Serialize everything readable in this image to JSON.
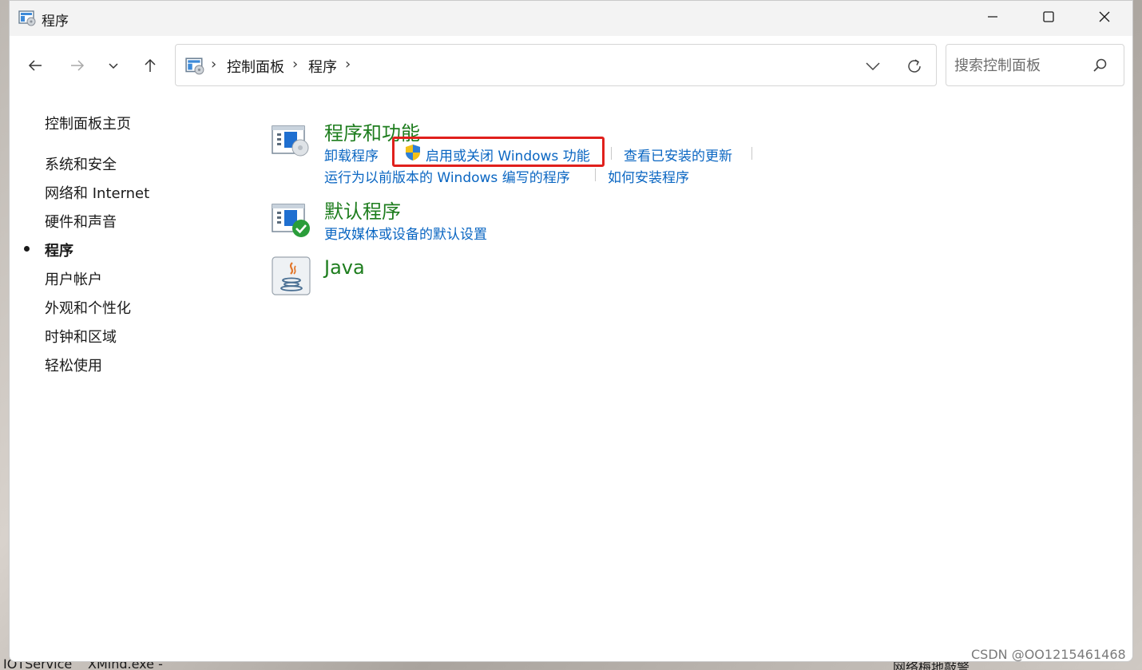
{
  "window": {
    "title": "程序",
    "minimize_icon": "minimize-icon",
    "maximize_icon": "maximize-icon",
    "close_icon": "close-icon"
  },
  "nav": {
    "back_icon": "arrow-left-icon",
    "forward_icon": "arrow-right-icon",
    "recent_icon": "chevron-down-icon",
    "up_icon": "arrow-up-icon"
  },
  "address": {
    "crumbs": [
      "控制面板",
      "程序"
    ],
    "dropdown_icon": "chevron-down-icon",
    "refresh_icon": "refresh-icon"
  },
  "search": {
    "placeholder": "搜索控制面板",
    "icon": "search-icon"
  },
  "sidebar": {
    "items": [
      {
        "label": "控制面板主页",
        "active": false
      },
      {
        "label": "系统和安全",
        "active": false
      },
      {
        "label": "网络和 Internet",
        "active": false
      },
      {
        "label": "硬件和声音",
        "active": false
      },
      {
        "label": "程序",
        "active": true
      },
      {
        "label": "用户帐户",
        "active": false
      },
      {
        "label": "外观和个性化",
        "active": false
      },
      {
        "label": "时钟和区域",
        "active": false
      },
      {
        "label": "轻松使用",
        "active": false
      }
    ]
  },
  "sections": {
    "programs": {
      "title": "程序和功能",
      "links": {
        "uninstall": "卸载程序",
        "windows_features": "启用或关闭 Windows 功能",
        "installed_updates": "查看已安装的更新",
        "compat": "运行为以前版本的 Windows 编写的程序",
        "how_install": "如何安装程序"
      }
    },
    "defaults": {
      "title": "默认程序",
      "links": {
        "media_defaults": "更改媒体或设备的默认设置"
      }
    },
    "java": {
      "title": "Java"
    }
  },
  "desktop": {
    "fragments": [
      "IOTService",
      "XMind.exe -",
      "网络梅地敲警"
    ]
  },
  "watermark": "CSDN @OO1215461468",
  "colors": {
    "link": "#0a66c2",
    "section_title": "#1e7d1e",
    "highlight": "#e0201c"
  }
}
